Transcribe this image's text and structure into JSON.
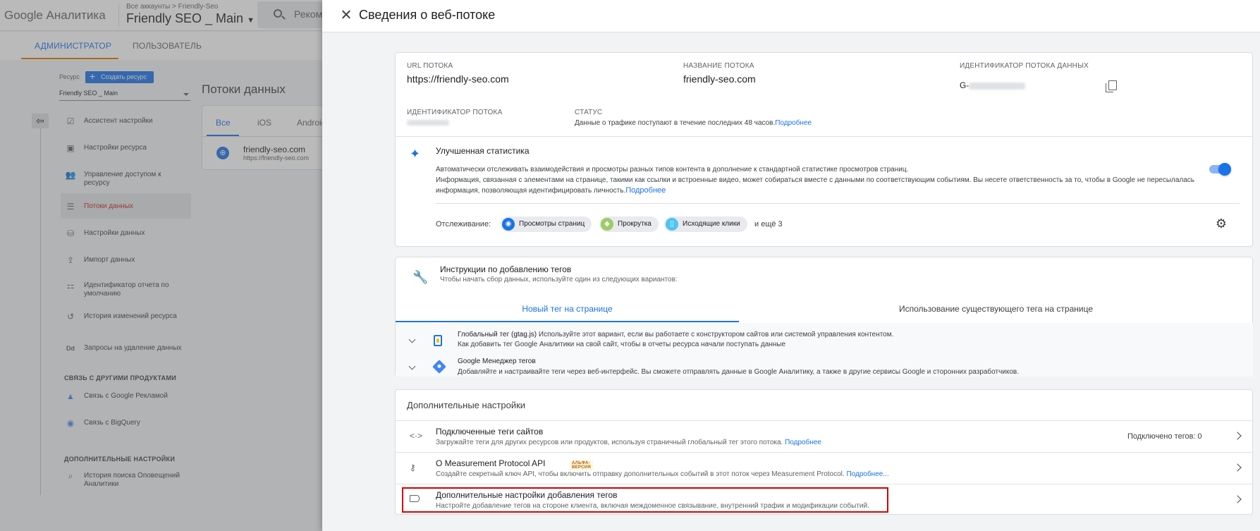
{
  "background": {
    "logo": "Google Аналитика",
    "breadcrumb_small": "Все аккаунты > Friendly-Seo",
    "account_name": "Friendly SEO _ Main",
    "search_placeholder": "Реком",
    "tabs": [
      "АДМИНИСТРАТОР",
      "ПОЛЬЗОВАТЕЛЬ"
    ],
    "resource_label": "Ресурс",
    "create_resource_button": "Создать ресурс",
    "resource_select": "Friendly SEO _ Main",
    "nav": [
      {
        "label": "Ассистент настройки",
        "icon": "checklist-icon"
      },
      {
        "label": "Настройки ресурса",
        "icon": "settings-icon"
      },
      {
        "label": "Управление доступом к ресурсу",
        "icon": "people-icon"
      },
      {
        "label": "Потоки данных",
        "icon": "streams-icon"
      },
      {
        "label": "Настройки данных",
        "icon": "database-icon"
      },
      {
        "label": "Импорт данных",
        "icon": "upload-icon"
      },
      {
        "label": "Идентификатор отчета по умолчанию",
        "icon": "identity-icon"
      },
      {
        "label": "История изменений ресурса",
        "icon": "history-icon"
      },
      {
        "label": "Запросы на удаление данных",
        "icon": "dd-icon"
      }
    ],
    "section_products": "СВЯЗЬ С ДРУГИМИ ПРОДУКТАМИ",
    "product_links": [
      {
        "label": "Связь с Google Рекламой",
        "icon": "google-ads-icon"
      },
      {
        "label": "Связь с BigQuery",
        "icon": "bigquery-icon"
      }
    ],
    "section_additional": "ДОПОЛНИТЕЛЬНЫЕ НАСТРОЙКИ",
    "additional_links": [
      {
        "label": "История поиска Оповещений Аналитики",
        "icon": "search-history-icon"
      }
    ],
    "page_title": "Потоки данных",
    "stream_tabs": [
      "Все",
      "iOS",
      "Android"
    ],
    "stream_item": {
      "name": "friendly-seo.com",
      "url": "https://friendly-seo.com"
    }
  },
  "panel": {
    "title": "Сведения о веб-потоке",
    "details": {
      "url_label": "URL ПОТОКА",
      "url_value": "https://friendly-seo.com",
      "name_label": "НАЗВАНИЕ ПОТОКА",
      "name_value": "friendly-seo.com",
      "measurement_label": "ИДЕНТИФИКАТОР ПОТОКА ДАННЫХ",
      "measurement_value": "G-",
      "stream_id_label": "ИДЕНТИФИКАТОР ПОТОКА",
      "status_label": "СТАТУС",
      "status_text": "Данные о трафике поступают в течение последних 48 часов.",
      "status_link": "Подробнее"
    },
    "enhanced": {
      "title": "Улучшенная статистика",
      "line1": "Автоматически отслеживать взаимодействия и просмотры разных типов контента в дополнение к стандартной статистике просмотров страниц.",
      "line2": "Информация, связанная с элементами на странице, такими как ссылки и встроенные видео, может собираться вместе с данными по соответствующим событиям. Вы несете ответственность за то, чтобы в Google не пересылалась",
      "line3": "информация, позволяющая идентифицировать личность.",
      "link": "Подробнее",
      "enabled": true,
      "tracking_label": "Отслеживание:",
      "chips": [
        "Просмотры страниц",
        "Прокрутка",
        "Исходящие клики"
      ],
      "more": "и ещё 3"
    },
    "tagging": {
      "title": "Инструкции по добавлению тегов",
      "subtitle": "Чтобы начать сбор данных, используйте один из следующих вариантов:",
      "tab_new": "Новый тег на странице",
      "tab_existing": "Использование существующего тега на странице",
      "gtag_title": "Глобальный тег (gtag.js)",
      "gtag_desc": "Используйте этот вариант, если вы работаете с конструктором сайтов или системой управления контентом.",
      "gtag_desc2": "Как добавить тег Google Аналитики на свой сайт, чтобы в отчеты ресурса начали поступать данные",
      "gtm_title": "Google Менеджер тегов",
      "gtm_desc": "Добавляйте и настраивайте теги через веб-интерфейс. Вы сможете отправлять данные в Google Аналитику, а также в другие сервисы Google и сторонних разработчиков."
    },
    "additional": {
      "title": "Дополнительные настройки",
      "connected_title": "Подключенные теги сайтов",
      "connected_desc": "Загружайте теги для других ресурсов или продуктов, используя страничный глобальный тег этого потока.",
      "connected_link": "Подробнее",
      "connected_count": "Подключено тегов: 0",
      "mp_title": "О Measurement Protocol API",
      "mp_badge": "АЛЬФА-ВЕРСИЯ",
      "mp_desc": "Создайте секретный ключ API, чтобы включить отправку дополнительных событий в этот поток через Measurement Protocol.",
      "mp_link": "Подробнее...",
      "tagging_title": "Дополнительные настройки добавления тегов",
      "tagging_desc": "Настройте добавление тегов на стороне клиента, включая междоменное связывание, внутренний трафик и модификации событий."
    }
  },
  "colors": {
    "accent": "#1a73e8",
    "highlight": "#d50000",
    "admin_tab": "#e37400"
  }
}
